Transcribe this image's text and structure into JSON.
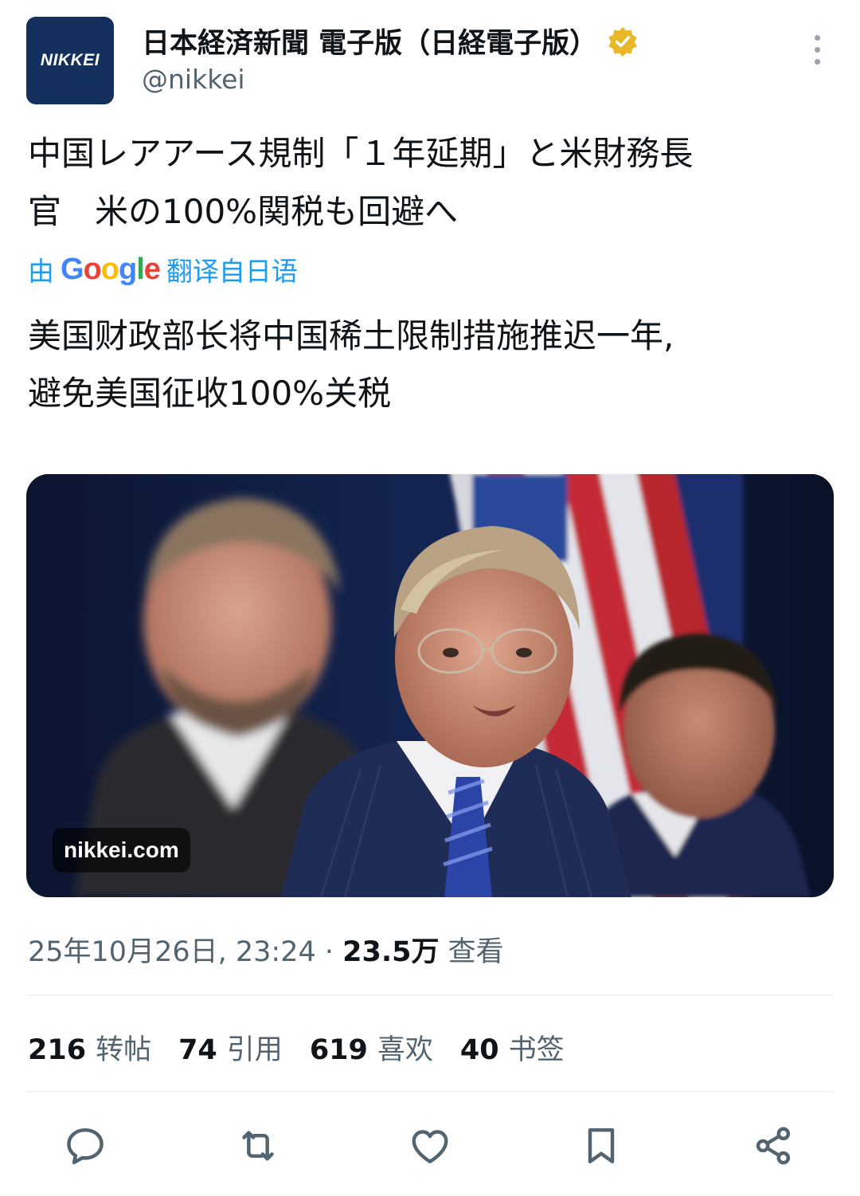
{
  "author": {
    "avatar_text": "NIKKEI",
    "display_name": "日本経済新聞 電子版（日経電子版）",
    "handle": "@nikkei",
    "verified_color": "#e8b829"
  },
  "post": {
    "original_text_line1": "中国レアアース規制「１年延期」と米財務長",
    "original_text_line2": "官　米の100%関税も回避へ",
    "translate_prefix": "由",
    "translate_brand": "Google",
    "translate_suffix": "翻译自日语",
    "translated_text_line1": "美国财政部长将中国稀土限制措施推迟一年,",
    "translated_text_line2": "避免美国征收100%关税",
    "image_source_label": "nikkei.com"
  },
  "meta": {
    "timestamp": "25年10月26日, 23:24",
    "separator": "·",
    "views_count": "23.5万",
    "views_label": "查看"
  },
  "stats": [
    {
      "count": "216",
      "label": "转帖"
    },
    {
      "count": "74",
      "label": "引用"
    },
    {
      "count": "619",
      "label": "喜欢"
    },
    {
      "count": "40",
      "label": "书签"
    }
  ],
  "actions": [
    "reply-icon",
    "repost-icon",
    "like-icon",
    "bookmark-icon",
    "share-icon"
  ],
  "colors": {
    "accent_blue": "#1d9bf0",
    "secondary_text": "#536471",
    "avatar_bg": "#14305c"
  }
}
